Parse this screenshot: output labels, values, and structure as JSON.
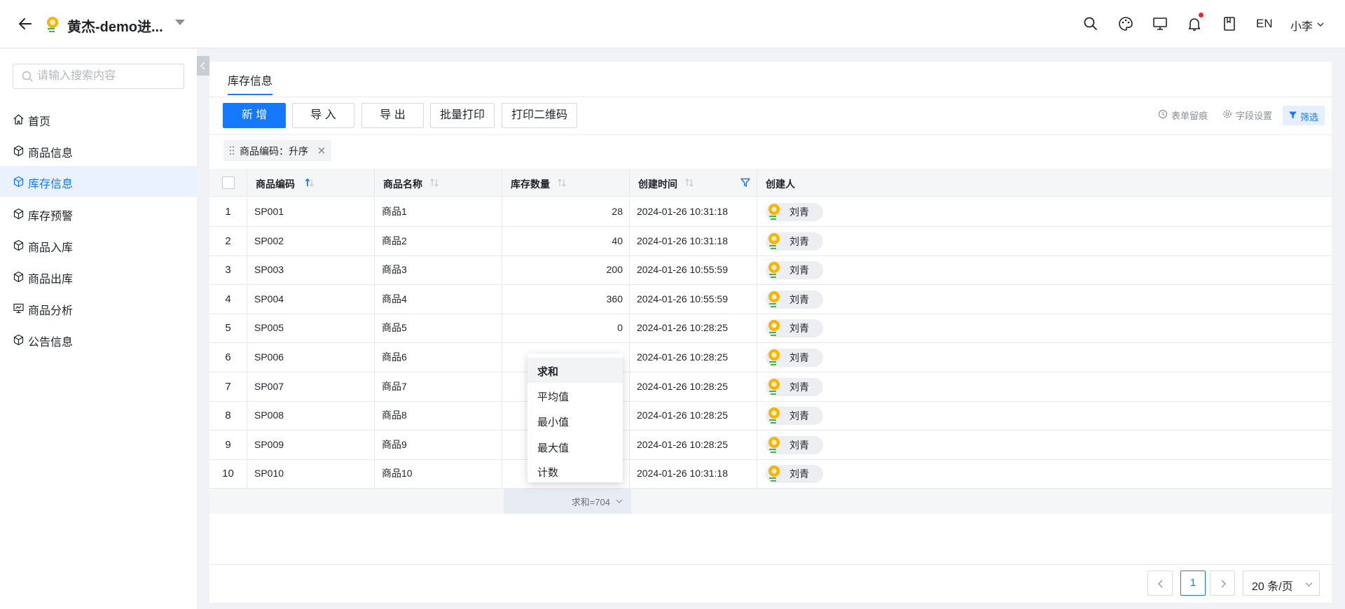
{
  "header": {
    "title": "黄杰-demo进...",
    "lang": "EN",
    "user": "小李"
  },
  "sidebar": {
    "search_placeholder": "请输入搜索内容",
    "items": [
      {
        "label": "首页",
        "icon": "home-icon"
      },
      {
        "label": "商品信息",
        "icon": "box-icon"
      },
      {
        "label": "库存信息",
        "icon": "box-icon",
        "active": true
      },
      {
        "label": "库存预警",
        "icon": "box-icon"
      },
      {
        "label": "商品入库",
        "icon": "box-icon"
      },
      {
        "label": "商品出库",
        "icon": "box-icon"
      },
      {
        "label": "商品分析",
        "icon": "chart-icon"
      },
      {
        "label": "公告信息",
        "icon": "box-icon"
      }
    ]
  },
  "main": {
    "tab": "库存信息",
    "buttons": {
      "add": "新 增",
      "import": "导 入",
      "export": "导 出",
      "batch_print": "批量打印",
      "print_qr": "打印二维码"
    },
    "tools": {
      "history": "表单留痕",
      "field_settings": "字段设置",
      "filter": "筛选"
    },
    "sort_chip": "商品编码：升序",
    "table": {
      "columns": [
        "商品编码",
        "商品名称",
        "库存数量",
        "创建时间",
        "创建人"
      ],
      "rows": [
        {
          "idx": "1",
          "code": "SP001",
          "name": "商品1",
          "qty": "28",
          "time": "2024-01-26 10:31:18",
          "creator": "刘青"
        },
        {
          "idx": "2",
          "code": "SP002",
          "name": "商品2",
          "qty": "40",
          "time": "2024-01-26 10:31:18",
          "creator": "刘青"
        },
        {
          "idx": "3",
          "code": "SP003",
          "name": "商品3",
          "qty": "200",
          "time": "2024-01-26 10:55:59",
          "creator": "刘青"
        },
        {
          "idx": "4",
          "code": "SP004",
          "name": "商品4",
          "qty": "360",
          "time": "2024-01-26 10:55:59",
          "creator": "刘青"
        },
        {
          "idx": "5",
          "code": "SP005",
          "name": "商品5",
          "qty": "0",
          "time": "2024-01-26 10:28:25",
          "creator": "刘青"
        },
        {
          "idx": "6",
          "code": "SP006",
          "name": "商品6",
          "qty": "",
          "time": "2024-01-26 10:28:25",
          "creator": "刘青"
        },
        {
          "idx": "7",
          "code": "SP007",
          "name": "商品7",
          "qty": "",
          "time": "2024-01-26 10:28:25",
          "creator": "刘青"
        },
        {
          "idx": "8",
          "code": "SP008",
          "name": "商品8",
          "qty": "",
          "time": "2024-01-26 10:28:25",
          "creator": "刘青"
        },
        {
          "idx": "9",
          "code": "SP009",
          "name": "商品9",
          "qty": "",
          "time": "2024-01-26 10:28:25",
          "creator": "刘青"
        },
        {
          "idx": "10",
          "code": "SP010",
          "name": "商品10",
          "qty": "",
          "time": "2024-01-26 10:31:18",
          "creator": "刘青"
        }
      ],
      "summary": "求和=704"
    },
    "agg_menu": [
      "求和",
      "平均值",
      "最小值",
      "最大值",
      "计数"
    ],
    "pager": {
      "page": "1",
      "page_size": "20 条/页"
    }
  },
  "colors": {
    "accent": "#1677ff",
    "notification_dot": "#f5222d"
  }
}
